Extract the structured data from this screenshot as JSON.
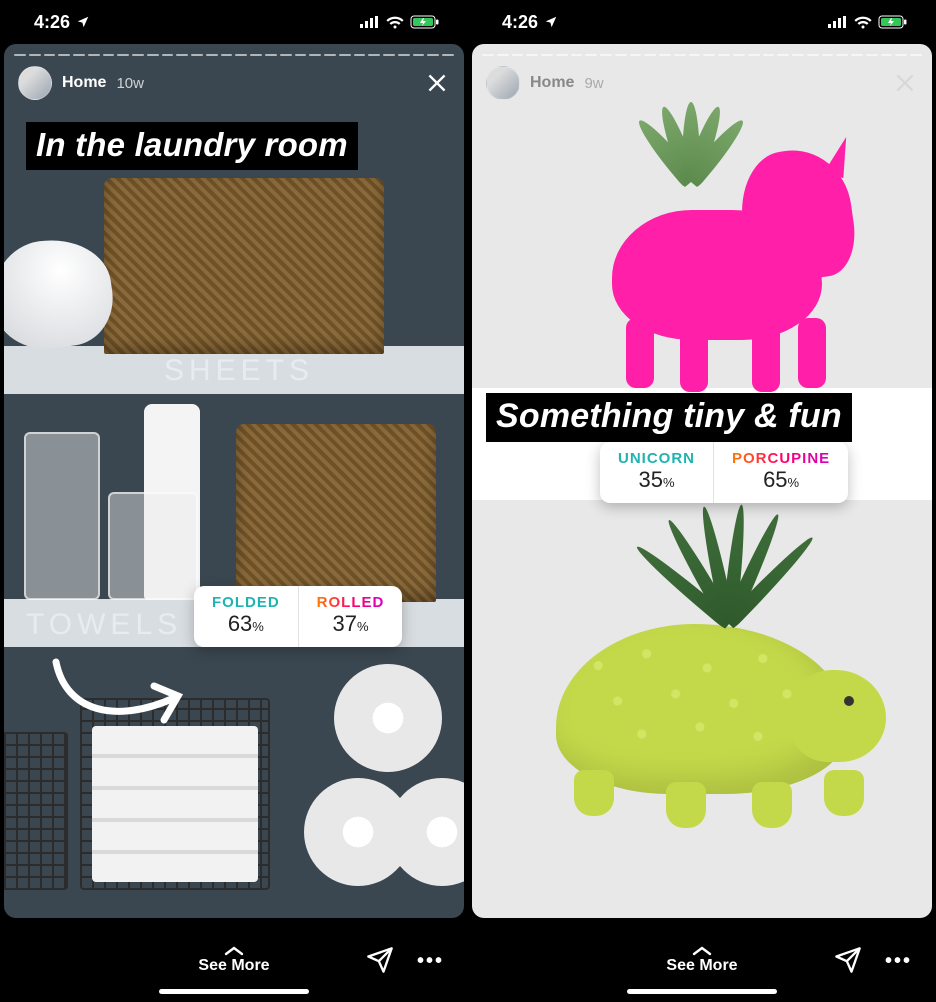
{
  "status": {
    "time": "4:26",
    "location_glyph": "➤"
  },
  "bottom": {
    "see_more": "See More",
    "more_glyph": "•••"
  },
  "stories": [
    {
      "user": "Home",
      "age": "10w",
      "caption": "In the laundry room",
      "shelf_labels": {
        "sheets": "SHEETS",
        "towels": "TOWELS"
      },
      "poll": {
        "left": {
          "label": "FOLDED",
          "value": "63",
          "pct": "%"
        },
        "right": {
          "label": "ROLLED",
          "value": "37",
          "pct": "%"
        }
      }
    },
    {
      "user": "Home",
      "age": "9w",
      "caption": "Something tiny & fun",
      "poll": {
        "left": {
          "label": "UNICORN",
          "value": "35",
          "pct": "%"
        },
        "right": {
          "label": "PORCUPINE",
          "value": "65",
          "pct": "%"
        }
      }
    }
  ]
}
